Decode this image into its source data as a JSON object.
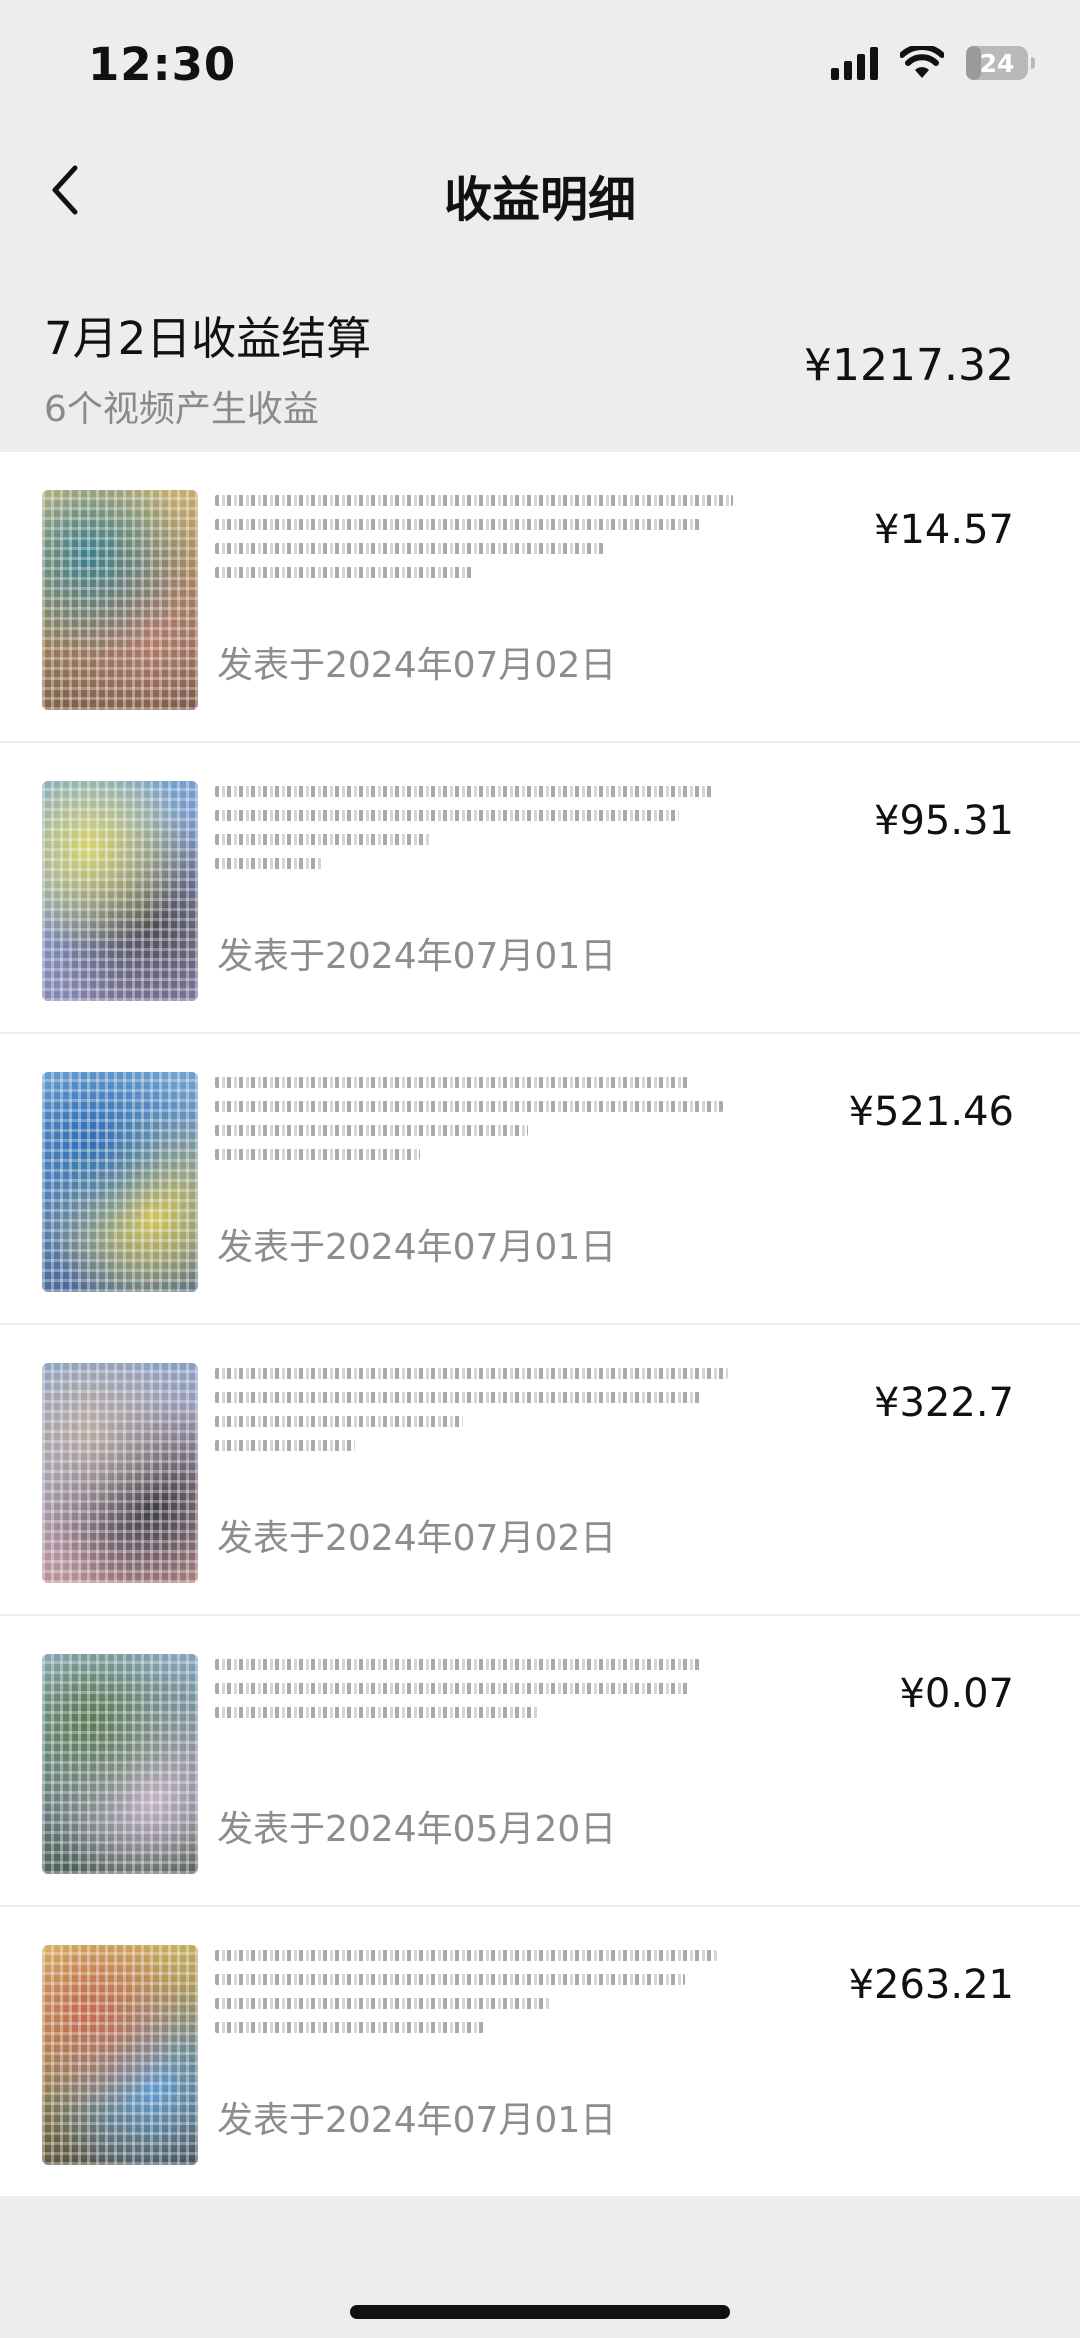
{
  "status_bar": {
    "time": "12:30",
    "battery": "24",
    "battery_level": 0.24,
    "icons": [
      "signal-icon",
      "wifi-icon",
      "battery-icon"
    ]
  },
  "nav": {
    "title": "收益明细",
    "back_icon": "chevron-left-icon"
  },
  "summary": {
    "date_label": "7月2日收益结算",
    "sub_label": "6个视频产生收益",
    "total": "¥1217.32"
  },
  "items": [
    {
      "date": "发表于2024年07月02日",
      "amount": "¥14.57",
      "thumb_colors": [
        "#3a7e8c",
        "#b07a6a",
        "#6b4a3e",
        "#d9c47a"
      ]
    },
    {
      "date": "发表于2024年07月01日",
      "amount": "¥95.31",
      "thumb_colors": [
        "#d8d36e",
        "#4d4a52",
        "#8a7ea8",
        "#6fa6d8"
      ]
    },
    {
      "date": "发表于2024年07月01日",
      "amount": "¥521.46",
      "thumb_colors": [
        "#2f6fb5",
        "#d6c657",
        "#3f5a8a",
        "#7bb0de"
      ]
    },
    {
      "date": "发表于2024年07月02日",
      "amount": "¥322.7",
      "thumb_colors": [
        "#b8a9a2",
        "#3b3a44",
        "#c98d8a",
        "#7da2cf"
      ]
    },
    {
      "date": "发表于2024年05月20日",
      "amount": "¥0.07",
      "thumb_colors": [
        "#5a7a52",
        "#c4b3c9",
        "#3c4b3a",
        "#98b8d6"
      ]
    },
    {
      "date": "发表于2024年07月01日",
      "amount": "¥263.21",
      "thumb_colors": [
        "#c46a4f",
        "#5d9bd1",
        "#3d3a36",
        "#e2c86a"
      ]
    }
  ]
}
